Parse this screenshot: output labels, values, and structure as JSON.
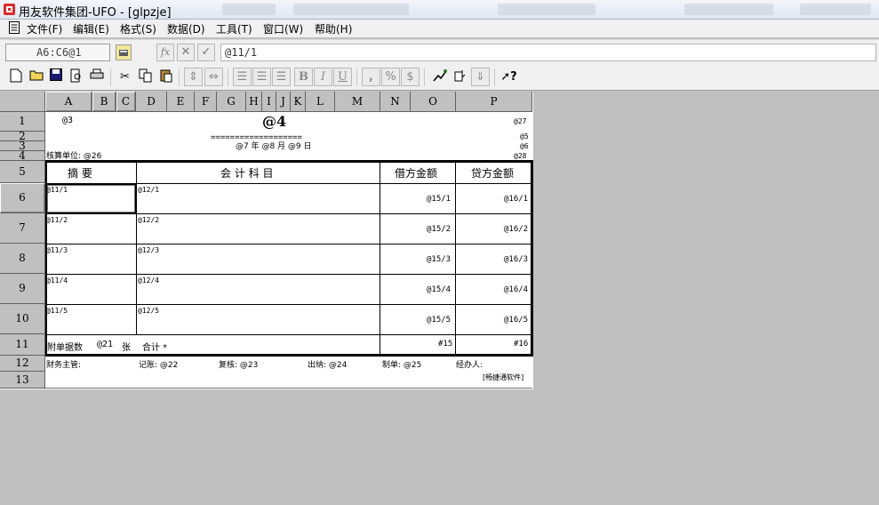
{
  "window": {
    "title": "用友软件集团-UFO - [glpzje]"
  },
  "menu": [
    "文件(F)",
    "编辑(E)",
    "格式(S)",
    "数据(D)",
    "工具(T)",
    "窗口(W)",
    "帮助(H)"
  ],
  "formula_bar": {
    "cell_ref": "A6:C6@1",
    "formula": "@11/1"
  },
  "columns": [
    "A",
    "B",
    "C",
    "D",
    "E",
    "F",
    "G",
    "H",
    "I",
    "J",
    "K",
    "L",
    "M",
    "N",
    "O",
    "P"
  ],
  "rows": [
    "1",
    "2",
    "3",
    "4",
    "5",
    "6",
    "7",
    "8",
    "9",
    "10",
    "11",
    "12",
    "13"
  ],
  "sheet": {
    "r1_left": "@3",
    "r1_title": "@4",
    "r1_right": "@27",
    "r2_rule": "===================",
    "r2_right": "@5",
    "r3_date": "@7 年 @8 月 @9 日",
    "r3_right": "@6",
    "r4_left": "核算单位: @26",
    "r4_right": "@28",
    "headers": {
      "summary": "摘    要",
      "account": "会  计  科  目",
      "debit": "借方金额",
      "credit": "贷方金额"
    },
    "lines": [
      {
        "summary": "@11/1",
        "account": "@12/1",
        "debit": "@15/1",
        "credit": "@16/1"
      },
      {
        "summary": "@11/2",
        "account": "@12/2",
        "debit": "@15/2",
        "credit": "@16/2"
      },
      {
        "summary": "@11/3",
        "account": "@12/3",
        "debit": "@15/3",
        "credit": "@16/3"
      },
      {
        "summary": "@11/4",
        "account": "@12/4",
        "debit": "@15/4",
        "credit": "@16/4"
      },
      {
        "summary": "@11/5",
        "account": "@12/5",
        "debit": "@15/5",
        "credit": "@16/5"
      }
    ],
    "total_row": {
      "attachments": "附单据数",
      "attach_val": "@21",
      "attach_unit": "张",
      "total_label": "合计 *",
      "debit": "#15",
      "credit": "#16"
    },
    "footer": {
      "manager": "财务主管:",
      "bookkeeper": "记账: @22",
      "reviewer": "复核: @23",
      "cashier": "出纳: @24",
      "preparer": "制单: @25",
      "handler": "经办人:",
      "brand": "[畅捷通软件]"
    }
  }
}
